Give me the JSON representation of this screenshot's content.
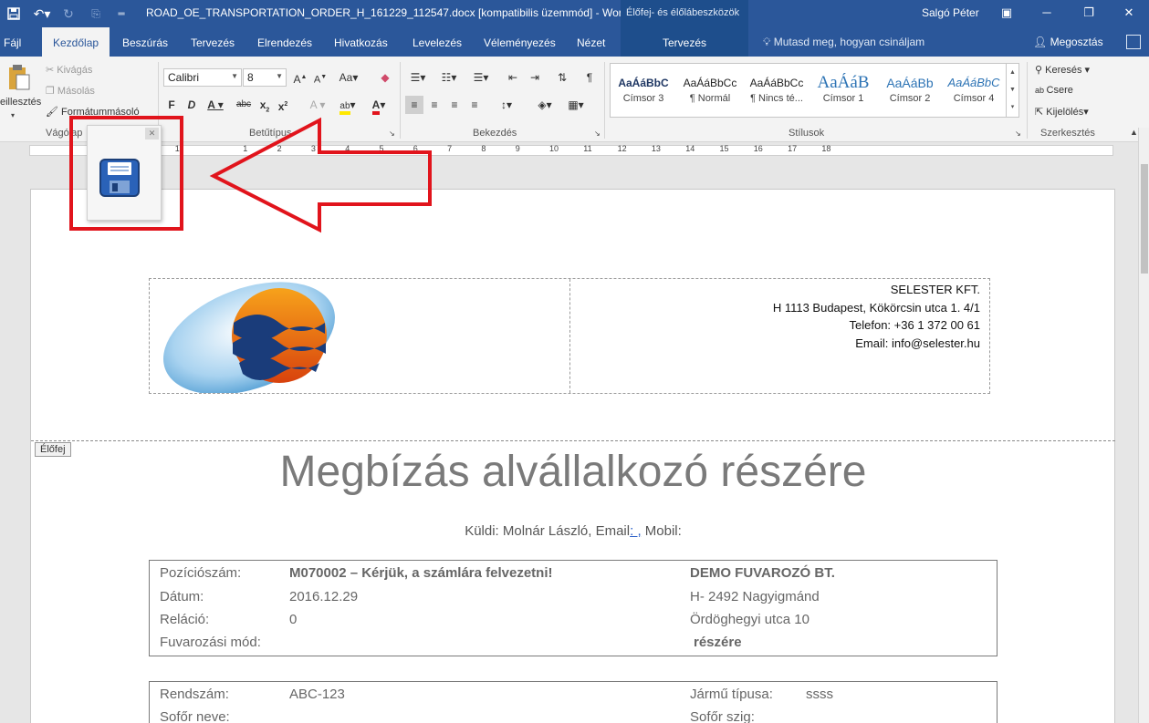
{
  "titlebar": {
    "doc_title": "ROAD_OE_TRANSPORTATION_ORDER_H_161229_112547.docx [kompatibilis üzemmód]  -  Word",
    "context_title": "Élőfej- és élőlábeszközök",
    "user": "Salgó Péter"
  },
  "tabs": [
    "Fájl",
    "Kezdőlap",
    "Beszúrás",
    "Tervezés",
    "Elrendezés",
    "Hivatkozás",
    "Levelezés",
    "Véleményezés",
    "Nézet"
  ],
  "context_tab": "Tervezés",
  "tell_me": "Mutasd meg, hogyan csináljam",
  "share": "Megosztás",
  "ribbon": {
    "clipboard": {
      "paste": "eillesztés",
      "cut": "Kivágás",
      "copy": "Másolás",
      "format_painter": "Formátummásoló",
      "label": "Vágólap"
    },
    "font": {
      "font_name": "Calibri",
      "font_size": "8",
      "label": "Betűtípus"
    },
    "paragraph": {
      "label": "Bekezdés"
    },
    "styles": {
      "label": "Stílusok",
      "items": [
        {
          "preview": "AaÁáBbC",
          "name": "Címsor 3"
        },
        {
          "preview": "AaÁáBbCc",
          "name": "¶ Normál"
        },
        {
          "preview": "AaÁáBbCc",
          "name": "¶ Nincs té..."
        },
        {
          "preview": "AaÁáB",
          "name": "Címsor 1"
        },
        {
          "preview": "AaÁáBb",
          "name": "Címsor 2"
        },
        {
          "preview": "AaÁáBbC",
          "name": "Címsor 4"
        }
      ]
    },
    "editing": {
      "find": "Keresés",
      "replace": "Csere",
      "select": "Kijelölés",
      "label": "Szerkesztés"
    }
  },
  "ruler_numbers": [
    "1",
    "1",
    "2",
    "3",
    "4",
    "5",
    "6",
    "7",
    "8",
    "9",
    "10",
    "11",
    "12",
    "13",
    "14",
    "15",
    "16",
    "17",
    "18"
  ],
  "document": {
    "company": {
      "name": "SELESTER KFT.",
      "address": "H 1113 Budapest, Kökörcsin utca 1. 4/1",
      "phone": "Telefon: +36 1 372 00 61",
      "email": "Email: info@selester.hu"
    },
    "header_tag": "Élőfej",
    "heading": "Megbízás alvállalkozó részére",
    "sender_prefix": "Küldi: Molnár László, Email",
    "sender_link": ": ,",
    "sender_suffix": " Mobil:",
    "order": {
      "position_label": "Pozíciószám:",
      "position_value": "M070002 – Kérjük, a számlára felvezetni!",
      "date_label": "Dátum:",
      "date_value": "2016.12.29",
      "relation_label": "Reláció:",
      "relation_value": "0",
      "mode_label": "Fuvarozási mód:",
      "carrier_name": "DEMO FUVAROZÓ BT.",
      "carrier_city": "H- 2492 Nagyigmánd",
      "carrier_street": "Ördöghegyi utca 10",
      "carrier_for": "részére"
    },
    "vehicle": {
      "plate_label": "Rendszám:",
      "plate_value": "ABC-123",
      "driver_label": "Sofőr neve:",
      "type_label": "Jármű típusa:",
      "type_value": "ssss",
      "driver_id_label": "Sofőr szig:"
    }
  },
  "colors": {
    "word_blue": "#2b579a",
    "highlight_red": "#e1141c"
  }
}
